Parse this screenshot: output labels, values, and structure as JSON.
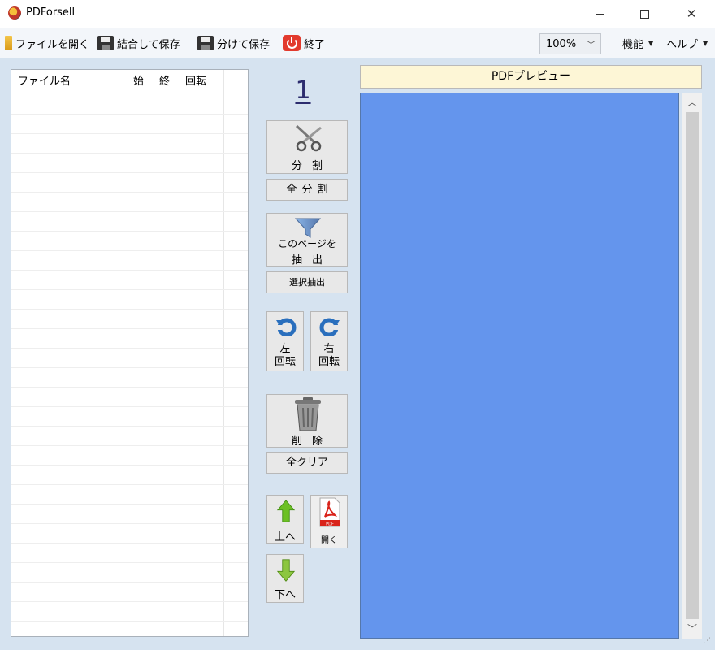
{
  "window": {
    "title": "PDForsell"
  },
  "menu": {
    "open": "ファイルを開く",
    "merge_save": "結合して保存",
    "split_save": "分けて保存",
    "exit": "終了",
    "zoom": "100%",
    "functions": "機能",
    "help": "ヘルプ"
  },
  "table": {
    "columns": [
      "ファイル名",
      "始",
      "終",
      "回転"
    ],
    "rows": []
  },
  "page_number": "1",
  "tools": {
    "split": "分割",
    "split_all": "全分割",
    "extract_line1": "このページを",
    "extract_line2": "抽出",
    "extract_selected": "選択抽出",
    "rotate_left_1": "左",
    "rotate_left_2": "回転",
    "rotate_right_1": "右",
    "rotate_right_2": "回転",
    "delete": "削除",
    "clear_all": "全クリア",
    "move_up": "上へ",
    "open_pdf": "開く",
    "pdf_badge": "PDF",
    "move_down": "下へ"
  },
  "preview": {
    "header": "PDFプレビュー",
    "canvas_color": "#6495ed"
  },
  "colors": {
    "panel_bg": "#d6e3f0",
    "menubar_bg": "#f3f6fa",
    "header_bg": "#fdf6d6"
  }
}
